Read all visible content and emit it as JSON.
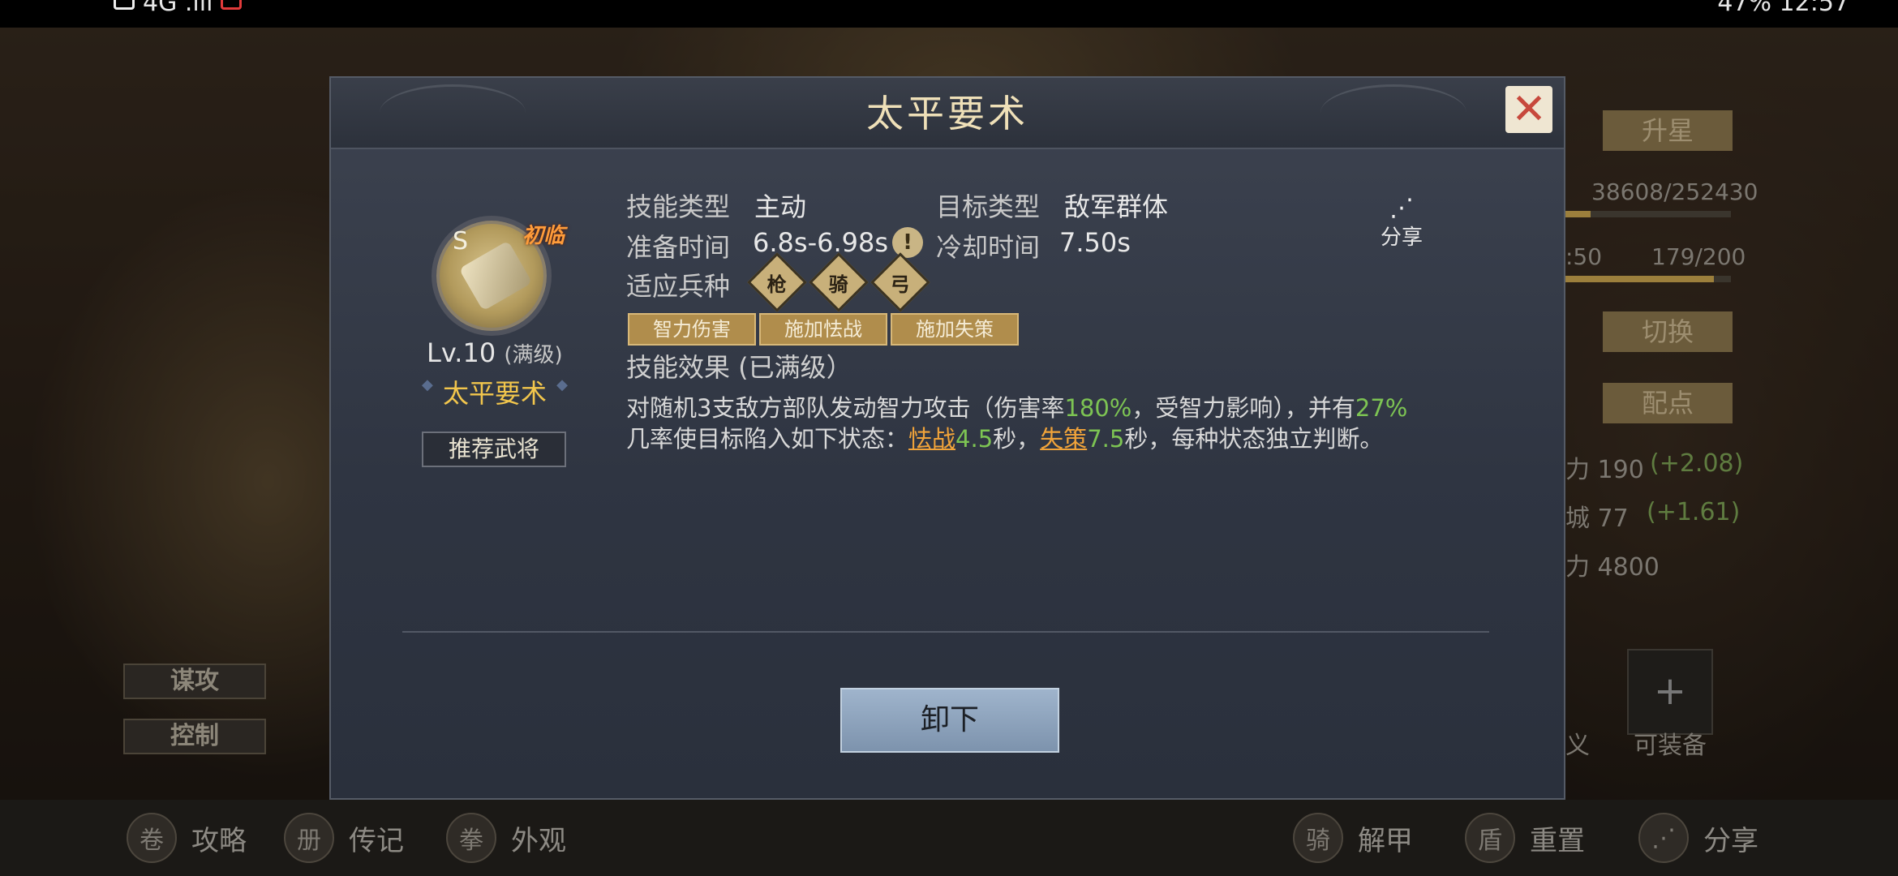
{
  "status_bar": {
    "left": "4G .ııl",
    "right": "47%  12:57"
  },
  "modal": {
    "title": "太平要术",
    "skill": {
      "grade": "S",
      "first_tag": "初临",
      "level": "Lv.10",
      "level_note": "(满级)",
      "name": "太平要术",
      "recommend_label": "推荐武将"
    },
    "info": {
      "skill_type_label": "技能类型",
      "skill_type_value": "主动",
      "target_type_label": "目标类型",
      "target_type_value": "敌军群体",
      "prep_time_label": "准备时间",
      "prep_time_value": "6.8s-6.98s",
      "cooldown_label": "冷却时间",
      "cooldown_value": "7.50s",
      "troop_label": "适应兵种",
      "troops": [
        "枪",
        "骑",
        "弓"
      ]
    },
    "share_label": "分享",
    "tags": [
      "智力伤害",
      "施加怯战",
      "施加失策"
    ],
    "effect_title": "技能效果 (已满级）",
    "effect": {
      "p1": "对随机3支敌方部队发动智力攻击（伤害率",
      "v1": "180%",
      "p2": "，受智力影响），并有",
      "v2": "27%",
      "p3": "几率使目标陷入如下状态：",
      "s1": "怯战",
      "d1": "4.5",
      "p4": "秒，",
      "s2": "失策",
      "d2": "7.5",
      "p5": "秒，每种状态独立判断。"
    },
    "unequip_label": "卸下"
  },
  "background": {
    "left_tags": [
      "谋攻",
      "控制"
    ],
    "right": {
      "star_up": "升星",
      "exp": "38608/252430",
      "stamina_time": ":50",
      "stamina": "179/200",
      "switch": "切换",
      "assign": "配点",
      "stat1": "力 190",
      "stat1_bonus": "(+2.08)",
      "stat2": "城 77",
      "stat2_bonus": "(+1.61)",
      "stat3": "力 4800",
      "slot_label_a": "义",
      "slot_label_b": "可装备"
    },
    "bottom_nav": [
      {
        "icon": "卷",
        "label": "攻略"
      },
      {
        "icon": "册",
        "label": "传记"
      },
      {
        "icon": "拳",
        "label": "外观"
      },
      {
        "icon": "骑",
        "label": "解甲"
      },
      {
        "icon": "盾",
        "label": "重置"
      },
      {
        "icon": "⋰",
        "label": "分享"
      }
    ],
    "progress": {
      "exp_fraction": 0.153,
      "stamina_fraction": 0.895
    }
  }
}
